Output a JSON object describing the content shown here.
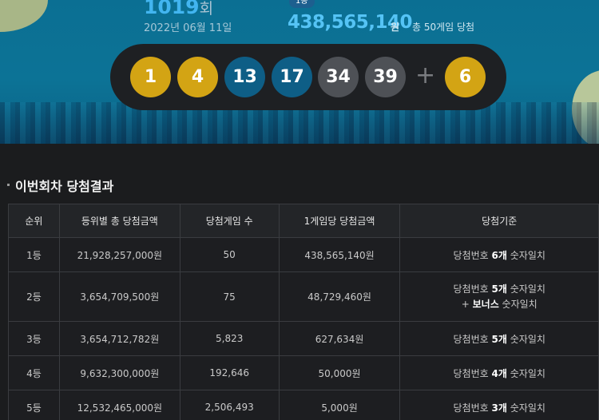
{
  "draw": {
    "round": "1019",
    "round_suffix": "회",
    "date": "2022년 06월 11일",
    "first_prize_badge": "1등",
    "first_prize_amount": "438,565,140",
    "first_prize_unit": "원",
    "first_prize_games": "총 50게임 당첨"
  },
  "numbers": [
    {
      "value": "1",
      "color": "#d3a414"
    },
    {
      "value": "4",
      "color": "#d3a414"
    },
    {
      "value": "13",
      "color": "#0e5e86"
    },
    {
      "value": "17",
      "color": "#0e5e86"
    },
    {
      "value": "34",
      "color": "#4e5156"
    },
    {
      "value": "39",
      "color": "#4e5156"
    }
  ],
  "plus_sign": "+",
  "bonus": {
    "value": "6",
    "color": "#d3a414"
  },
  "section_title": "이번회차 당첨결과",
  "table": {
    "headers": [
      "순위",
      "등위별 총 당첨금액",
      "당첨게임 수",
      "1게임당 당첨금액",
      "당첨기준"
    ],
    "rows": [
      {
        "rank": "1등",
        "total": "21,928,257,000원",
        "games": "50",
        "per_game": "438,565,140원",
        "crit_pre": "당첨번호 ",
        "crit_count": "6개",
        "crit_post": " 숫자일치",
        "bonus_pre": "",
        "bonus_bold": "",
        "bonus_post": ""
      },
      {
        "rank": "2등",
        "total": "3,654,709,500원",
        "games": "75",
        "per_game": "48,729,460원",
        "crit_pre": "당첨번호 ",
        "crit_count": "5개",
        "crit_post": " 숫자일치",
        "bonus_pre": "+ ",
        "bonus_bold": "보너스",
        "bonus_post": " 숫자일치"
      },
      {
        "rank": "3등",
        "total": "3,654,712,782원",
        "games": "5,823",
        "per_game": "627,634원",
        "crit_pre": "당첨번호 ",
        "crit_count": "5개",
        "crit_post": " 숫자일치",
        "bonus_pre": "",
        "bonus_bold": "",
        "bonus_post": ""
      },
      {
        "rank": "4등",
        "total": "9,632,300,000원",
        "games": "192,646",
        "per_game": "50,000원",
        "crit_pre": "당첨번호 ",
        "crit_count": "4개",
        "crit_post": " 숫자일치",
        "bonus_pre": "",
        "bonus_bold": "",
        "bonus_post": ""
      },
      {
        "rank": "5등",
        "total": "12,532,465,000원",
        "games": "2,506,493",
        "per_game": "5,000원",
        "crit_pre": "당첨번호 ",
        "crit_count": "3개",
        "crit_post": " 숫자일치",
        "bonus_pre": "",
        "bonus_bold": "",
        "bonus_post": ""
      }
    ]
  }
}
